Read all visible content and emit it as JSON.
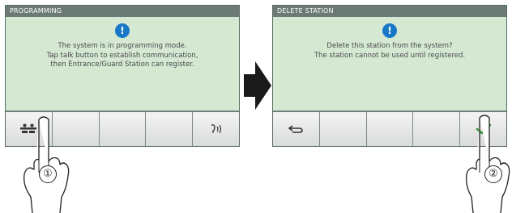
{
  "left_screen": {
    "title": "PROGRAMMING",
    "message": "The system is in programming mode.\nTap talk button to establish communication,\nthen Entrance/Guard Station can register.",
    "buttons": [
      "directory-icon",
      "",
      "",
      "",
      "talk-icon"
    ]
  },
  "right_screen": {
    "title": "DELETE STATION",
    "message": "Delete this station from the system?\nThe station cannot be used until registered.",
    "buttons": [
      "back-icon",
      "",
      "",
      "",
      "checkmark-icon"
    ]
  },
  "step_labels": [
    "①",
    "②"
  ],
  "colors": {
    "titlebar": "#6b7a74",
    "message_area": "#d4e8d2",
    "info_icon": "#1877c7",
    "checkmark": "#3a9a3a"
  }
}
